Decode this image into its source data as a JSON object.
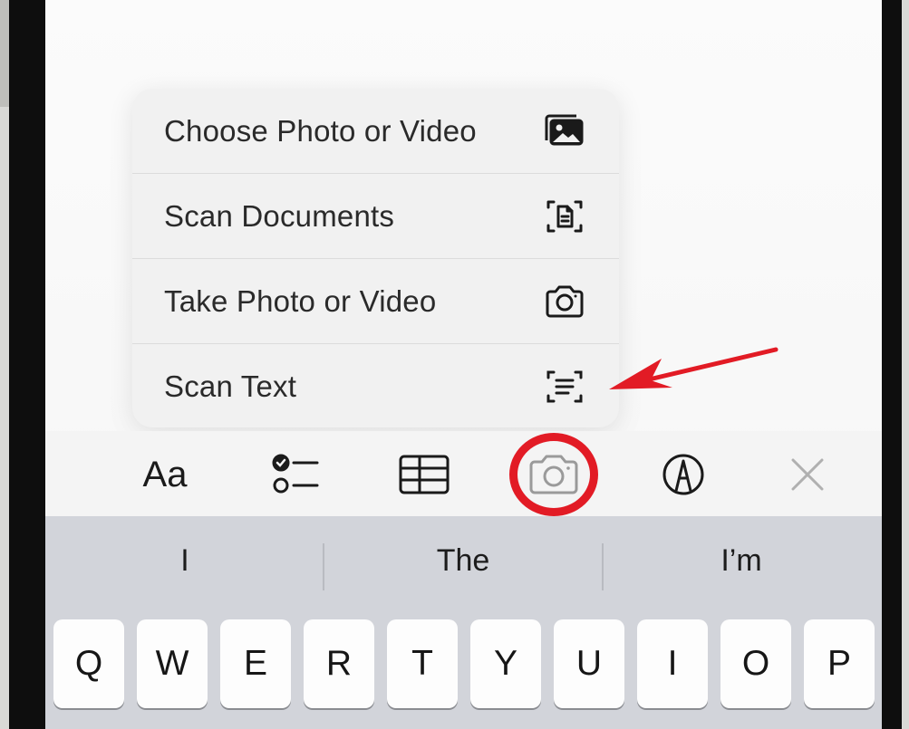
{
  "menu": {
    "items": [
      {
        "label": "Choose Photo or Video",
        "icon": "photo-library-icon"
      },
      {
        "label": "Scan Documents",
        "icon": "scan-document-icon"
      },
      {
        "label": "Take Photo or Video",
        "icon": "camera-icon"
      },
      {
        "label": "Scan Text",
        "icon": "scan-text-icon"
      }
    ]
  },
  "toolbar": {
    "format_label": "Aa",
    "tools": [
      "format-text",
      "checklist",
      "table",
      "camera",
      "markup",
      "close"
    ],
    "highlight_color": "#e21b25"
  },
  "keyboard": {
    "predictions": [
      "I",
      "The",
      "I’m"
    ],
    "top_row": [
      "Q",
      "W",
      "E",
      "R",
      "T",
      "Y",
      "U",
      "I",
      "O",
      "P"
    ]
  },
  "colors": {
    "annotation_red": "#e21b25",
    "keyboard_bg": "#d2d4da",
    "menu_bg": "#f1f1f1"
  }
}
